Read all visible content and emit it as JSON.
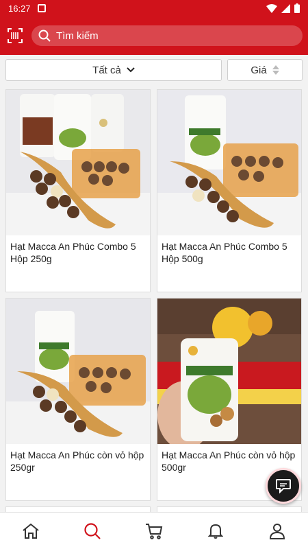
{
  "status_bar": {
    "time": "16:27"
  },
  "search": {
    "placeholder": "Tìm kiếm"
  },
  "filters": {
    "all_label": "Tất cả",
    "price_label": "Giá"
  },
  "products": [
    {
      "name": "Hạt Macca An Phúc Combo 5 Hộp 250g"
    },
    {
      "name": "Hạt Macca An Phúc Combo 5 Hộp 500g"
    },
    {
      "name": "Hạt Macca An Phúc còn vỏ hộp 250gr"
    },
    {
      "name": "Hạt Macca An Phúc còn vỏ hộp 500gr"
    }
  ],
  "bottom_nav": [
    "home-icon",
    "search-icon",
    "cart-icon",
    "bell-icon",
    "user-icon"
  ],
  "colors": {
    "brand_red": "#d0121b",
    "active_nav": "#d0121b",
    "inactive_nav": "#333333"
  }
}
